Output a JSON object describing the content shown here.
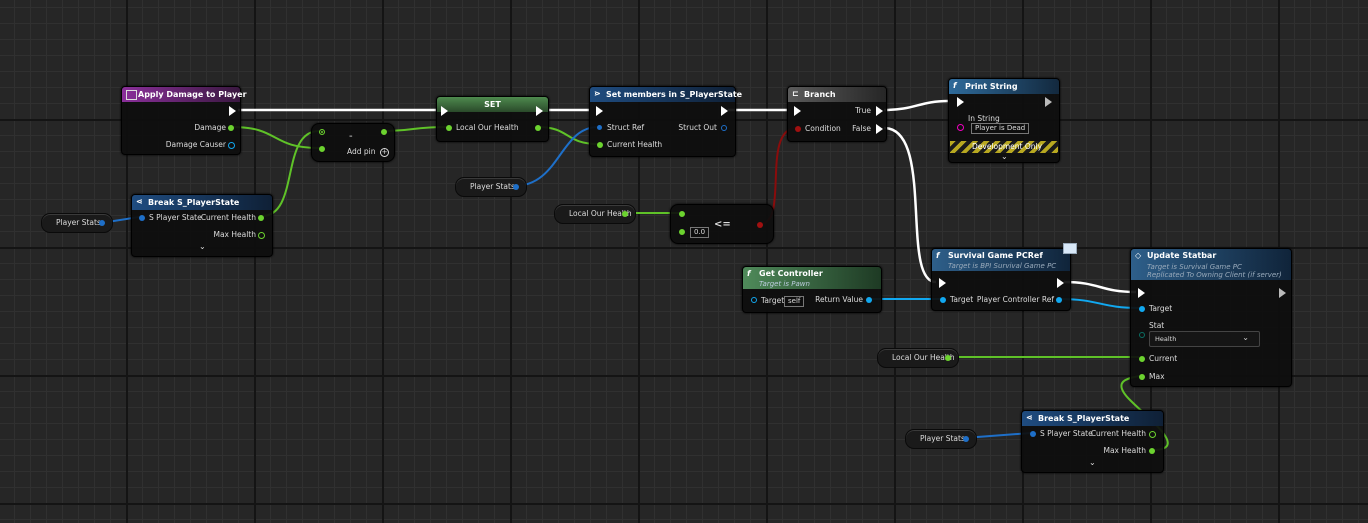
{
  "nodes": {
    "apply_damage": {
      "title": "Apply Damage to Player",
      "pin_damage": "Damage",
      "pin_damage_causer": "Damage Causer"
    },
    "break_top": {
      "title": "Break S_PlayerState",
      "pin_in": "S Player State",
      "pin_current": "Current Health",
      "pin_max": "Max Health",
      "chevron": "⌄"
    },
    "player_stats_top": {
      "label": "Player Stats"
    },
    "subtract": {
      "symbol": "-",
      "add_pin": "Add pin"
    },
    "set_node": {
      "title": "SET",
      "pin": "Local Our Health"
    },
    "player_stats_mid": {
      "label": "Player Stats"
    },
    "set_members": {
      "title": "Set members in S_PlayerState",
      "pin_struct_ref": "Struct Ref",
      "pin_current": "Current Health",
      "pin_struct_out": "Struct Out"
    },
    "local_health_mid": {
      "label": "Local Our Health"
    },
    "compare": {
      "symbol": "<=",
      "value": "0.0"
    },
    "branch": {
      "title": "Branch",
      "pin_condition": "Condition",
      "pin_true": "True",
      "pin_false": "False"
    },
    "print_string": {
      "title": "Print String",
      "pin_in_string": "In String",
      "value": "Player is Dead",
      "dev_only": "Development Only",
      "chevron": "⌄"
    },
    "get_controller": {
      "title": "Get Controller",
      "subtitle": "Target is Pawn",
      "pin_target": "Target",
      "target_value": "self",
      "pin_return": "Return Value"
    },
    "survival_cast": {
      "title": "Survival Game PCRef",
      "subtitle": "Target is BPI Survival Game PC",
      "pin_target": "Target",
      "pin_out": "Player Controller Ref"
    },
    "update_statbar": {
      "title": "Update Statbar",
      "subtitle1": "Target is Survival Game PC",
      "subtitle2": "Replicated To Owning Client (if server)",
      "pin_target": "Target",
      "pin_stat": "Stat",
      "stat_value": "Health",
      "pin_current": "Current",
      "pin_max": "Max"
    },
    "local_health_bottom": {
      "label": "Local Our Health"
    },
    "player_stats_bottom": {
      "label": "Player Stats"
    },
    "break_bottom": {
      "title": "Break S_PlayerState",
      "pin_in": "S Player State",
      "pin_current": "Current Health",
      "pin_max": "Max Health",
      "chevron": "⌄"
    }
  },
  "colors": {
    "event_header": "#7a2f8a",
    "break_header": "#1d4a7a",
    "set_header": "#3a6a3a",
    "branch_header": "#4a4a4a",
    "print_header": "#2e5f8a",
    "getctrl_header": "#3c6b46",
    "cast_header": "#2e5680",
    "update_header": "#2e5f8a",
    "float_pin": "#6cd32f",
    "struct_pin": "#1e6fc8",
    "object_pin": "#11a8f0",
    "bool_pin": "#a01010",
    "string_pin": "#f000c0",
    "byte_pin": "#0a6e62",
    "exec": "#ffffff"
  }
}
